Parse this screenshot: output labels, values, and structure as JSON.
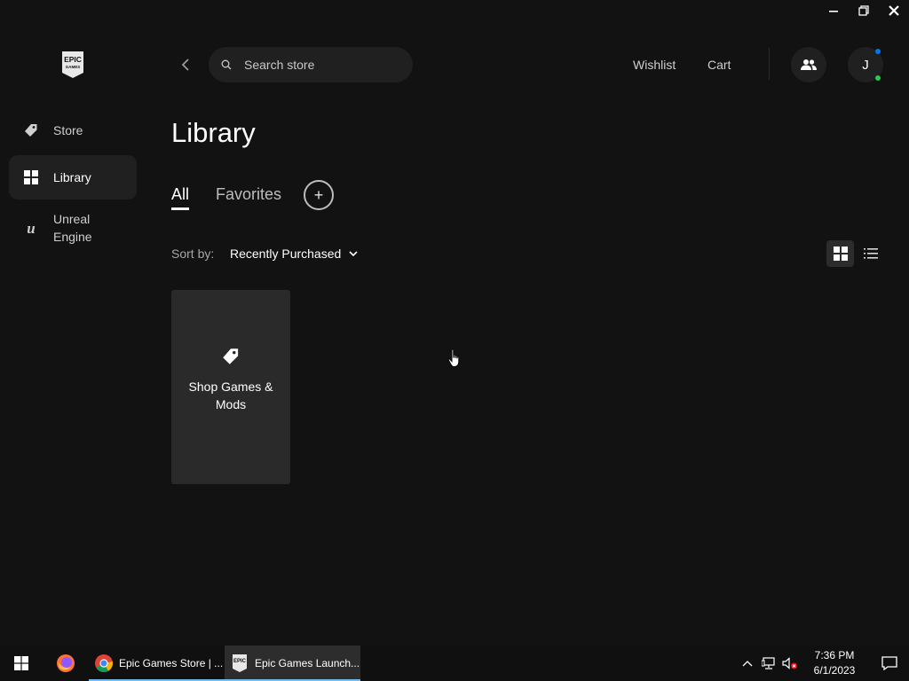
{
  "window": {
    "controls": [
      "minimize-icon",
      "restore-icon",
      "close-icon"
    ]
  },
  "logo": {
    "line1": "EPIC",
    "line2": "GAMES"
  },
  "sidebar": {
    "items": [
      {
        "label": "Store",
        "icon": "tag-icon",
        "active": false
      },
      {
        "label": "Library",
        "icon": "grid-icon",
        "active": true
      },
      {
        "label_line1": "Unreal",
        "label_line2": "Engine",
        "icon": "unreal-icon",
        "active": false
      }
    ]
  },
  "header": {
    "search_placeholder": "Search store",
    "wishlist": "Wishlist",
    "cart": "Cart",
    "avatar_initial": "J",
    "status_colors": {
      "notification": "#0078f2",
      "online": "#2ac84f"
    }
  },
  "main": {
    "title": "Library",
    "tabs": [
      {
        "label": "All",
        "active": true
      },
      {
        "label": "Favorites",
        "active": false
      }
    ],
    "add_tab": "+",
    "sort_label": "Sort by:",
    "sort_value": "Recently Purchased",
    "view_modes": [
      {
        "name": "grid-view",
        "active": true
      },
      {
        "name": "list-view",
        "active": false
      }
    ],
    "cards": [
      {
        "line1": "Shop Games &",
        "line2": "Mods",
        "icon": "tag-icon"
      }
    ]
  },
  "taskbar": {
    "apps": [
      {
        "name": "firefox",
        "label": ""
      },
      {
        "name": "chrome",
        "label": "Epic Games Store | ..."
      },
      {
        "name": "epic-launcher",
        "label": "Epic Games Launch...",
        "active": true
      }
    ],
    "time": "7:36 PM",
    "date": "6/1/2023"
  },
  "colors": {
    "background": "#121212",
    "sidebar_active": "#202020",
    "card": "#2a2a2a",
    "taskbar": "#101010",
    "accent_blue": "#0078f2"
  }
}
